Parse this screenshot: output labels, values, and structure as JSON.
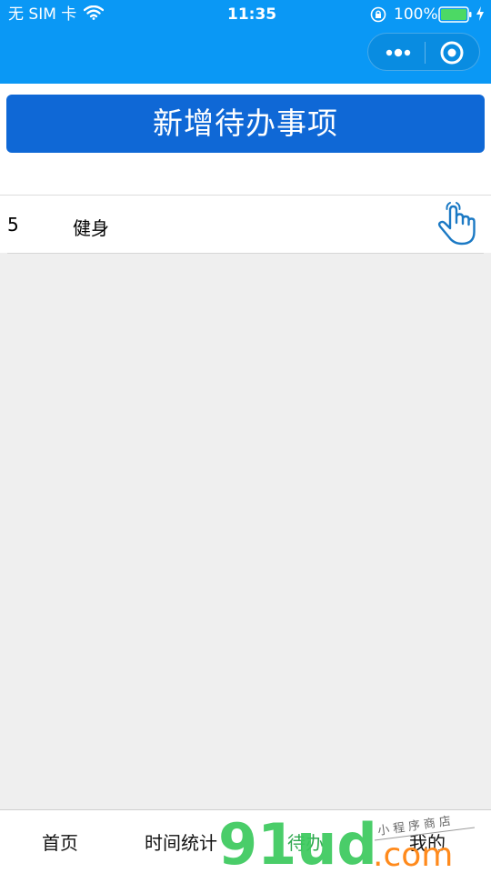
{
  "status_bar": {
    "carrier": "无 SIM 卡",
    "time": "11:35",
    "battery": "100%"
  },
  "main": {
    "add_button_label": "新增待办事项",
    "todos": [
      {
        "id": "5",
        "name": "健身"
      }
    ]
  },
  "tab_bar": {
    "tabs": [
      {
        "label": "首页"
      },
      {
        "label": "时间统计"
      },
      {
        "label": "待办",
        "active": true
      },
      {
        "label": "我的"
      }
    ]
  },
  "watermark": {
    "logo": "91ud",
    "suffix": ".com",
    "tagline": "小程序商店"
  },
  "colors": {
    "nav": "#0a98f5",
    "button": "#0f68d6",
    "active_tab": "#2fa84f",
    "watermark": "#3bc95c"
  }
}
